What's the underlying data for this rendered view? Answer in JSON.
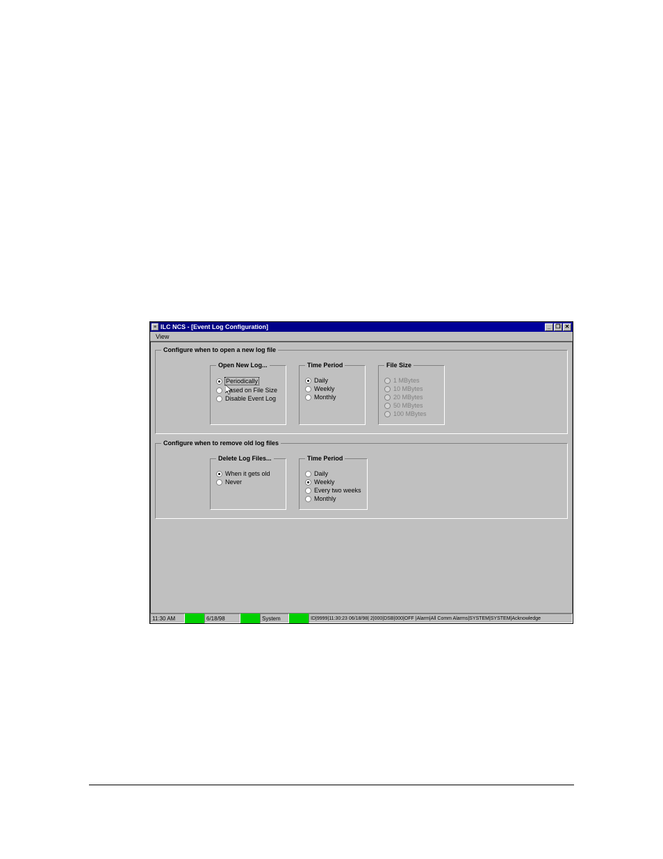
{
  "window": {
    "title": "ILC NCS - [Event Log Configuration]"
  },
  "menu": {
    "view": "View"
  },
  "group_open": {
    "title": "Configure when to open a new log file",
    "open_new_log": {
      "legend": "Open New Log...",
      "opts": {
        "periodically": "Periodically",
        "based_on_size": "Based on File Size",
        "disable": "Disable Event Log"
      },
      "selected": "periodically"
    },
    "time_period": {
      "legend": "Time Period",
      "opts": {
        "daily": "Daily",
        "weekly": "Weekly",
        "monthly": "Monthly"
      },
      "selected": "daily"
    },
    "file_size": {
      "legend": "File Size",
      "opts": {
        "mb1": "1 MBytes",
        "mb10": "10 MBytes",
        "mb20": "20 MBytes",
        "mb50": "50 MBytes",
        "mb100": "100 MBytes"
      },
      "disabled": true
    }
  },
  "group_remove": {
    "title": "Configure when to remove old log files",
    "delete": {
      "legend": "Delete Log Files...",
      "opts": {
        "when_old": "When it gets old",
        "never": "Never"
      },
      "selected": "when_old"
    },
    "time_period": {
      "legend": "Time Period",
      "opts": {
        "daily": "Daily",
        "weekly": "Weekly",
        "two_weeks": "Every two weeks",
        "monthly": "Monthly"
      },
      "selected": "weekly"
    }
  },
  "status": {
    "time": "11:30 AM",
    "date": "6/18/98",
    "system": "System",
    "rest": "ID|9999|11:30:23 06/18/98| 2|000|DSB|000|OFF |Alarm|All Comm Alarms|SYSTEM|SYSTEM|Acknowledge"
  }
}
